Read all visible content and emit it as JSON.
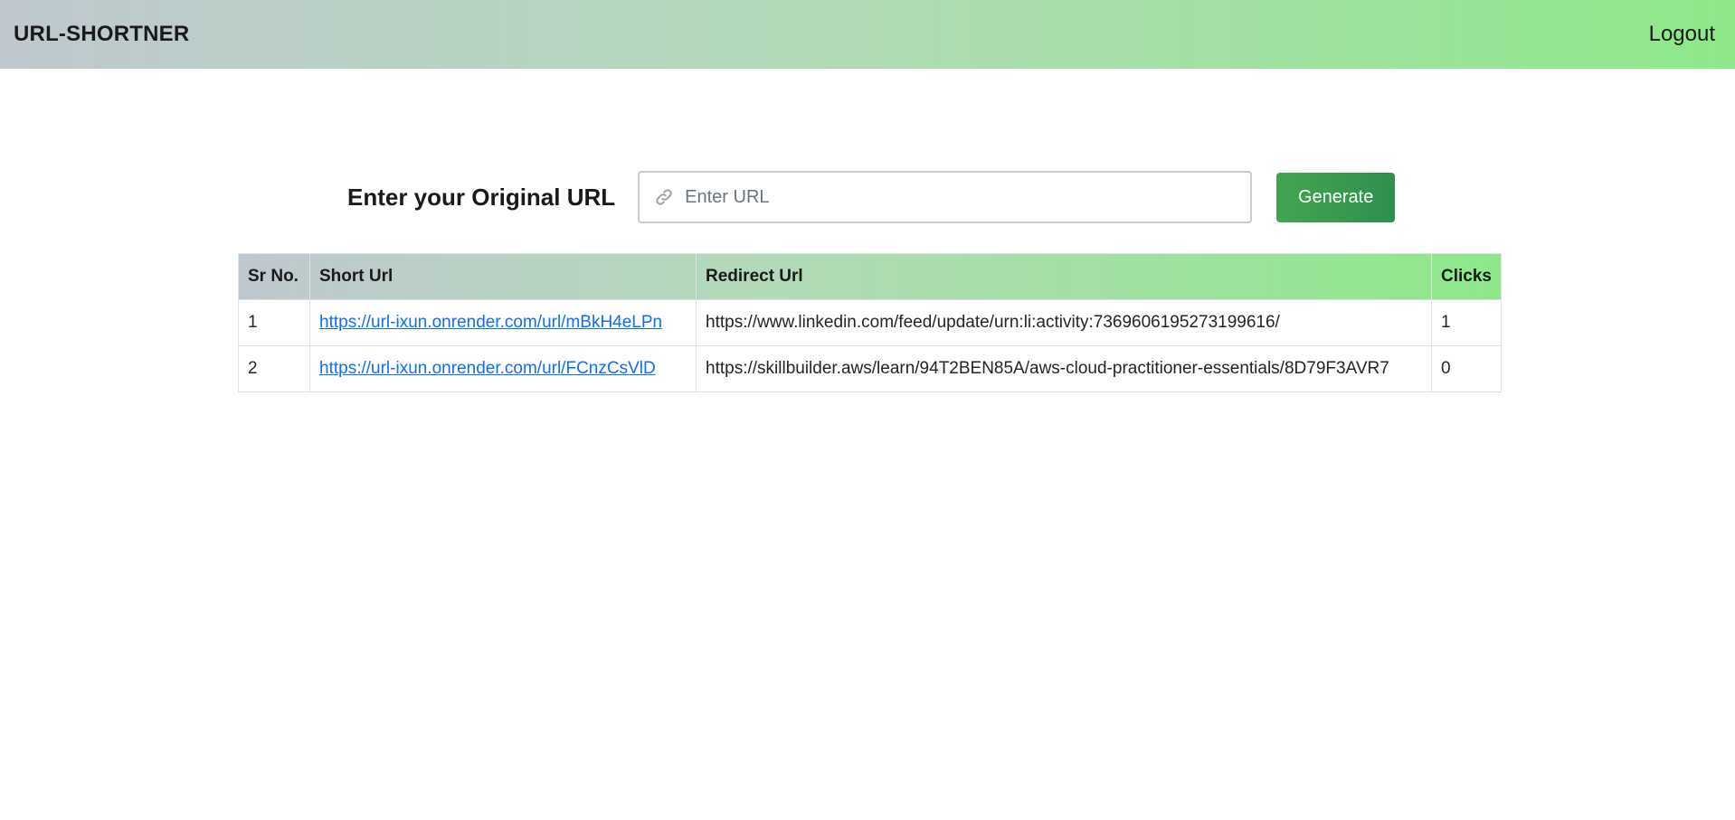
{
  "navbar": {
    "brand": "URL-SHORTNER",
    "logout_label": "Logout"
  },
  "form": {
    "label": "Enter your Original URL",
    "input_value": "",
    "input_placeholder": "Enter URL",
    "input_icon": "link-icon",
    "generate_label": "Generate"
  },
  "table": {
    "headers": {
      "sr": "Sr No.",
      "short": "Short Url",
      "redirect": "Redirect Url",
      "clicks": "Clicks"
    },
    "rows": [
      {
        "sr": "1",
        "short": "https://url-ixun.onrender.com/url/mBkH4eLPn",
        "redirect": "https://www.linkedin.com/feed/update/urn:li:activity:7369606195273199616/",
        "clicks": "1"
      },
      {
        "sr": "2",
        "short": "https://url-ixun.onrender.com/url/FCnzCsVlD",
        "redirect": "https://skillbuilder.aws/learn/94T2BEN85A/aws-cloud-practitioner-essentials/8D79F3AVR7",
        "clicks": "0"
      }
    ]
  },
  "colors": {
    "navbar_gradient_start": "#bfc8cf",
    "navbar_gradient_end": "#8ee88a",
    "generate_button": "#3a9a51",
    "link": "#0d6efd"
  }
}
